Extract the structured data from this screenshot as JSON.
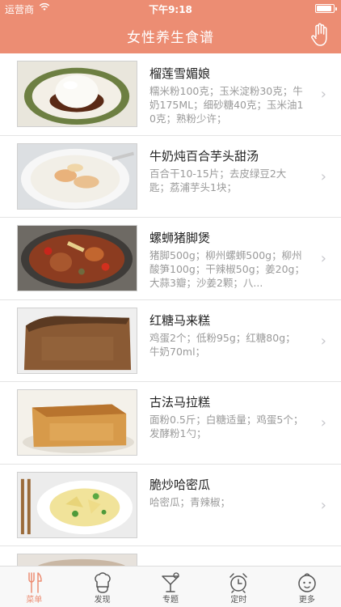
{
  "status": {
    "carrier": "运营商",
    "time": "下午9:18",
    "battery_level": 0.92
  },
  "nav": {
    "title": "女性养生食谱"
  },
  "recipes": [
    {
      "title": "榴莲雪媚娘",
      "ingredients": "糯米粉100克；玉米淀粉30克；牛奶175ML；细砂糖40克；玉米油10克；熟粉少许；"
    },
    {
      "title": "牛奶炖百合芋头甜汤",
      "ingredients": "百合干10-15片；去皮绿豆2大匙；荔浦芋头1块；"
    },
    {
      "title": "螺蛳猪脚煲",
      "ingredients": "猪脚500g；柳州螺蛳500g；柳州酸笋100g；干辣椒50g；姜20g；大蒜3瓣；沙姜2颗；八..."
    },
    {
      "title": "红糖马来糕",
      "ingredients": "鸡蛋2个；低粉95g；红糖80g；牛奶70ml；"
    },
    {
      "title": "古法马拉糕",
      "ingredients": "面粉0.5斤；白糖适量；鸡蛋5个；发酵粉1勺；"
    },
    {
      "title": "脆炒哈密瓜",
      "ingredients": "哈密瓜；青辣椒；"
    }
  ],
  "tabs": [
    {
      "label": "菜单",
      "icon": "fork-knife-icon",
      "active": true
    },
    {
      "label": "发现",
      "icon": "chef-hat-icon",
      "active": false
    },
    {
      "label": "专题",
      "icon": "cocktail-icon",
      "active": false
    },
    {
      "label": "定时",
      "icon": "alarm-clock-icon",
      "active": false
    },
    {
      "label": "更多",
      "icon": "baby-face-icon",
      "active": false
    }
  ],
  "colors": {
    "accent": "#ec8d73",
    "tab_inactive": "#555555",
    "divider": "#e4e4e4"
  }
}
